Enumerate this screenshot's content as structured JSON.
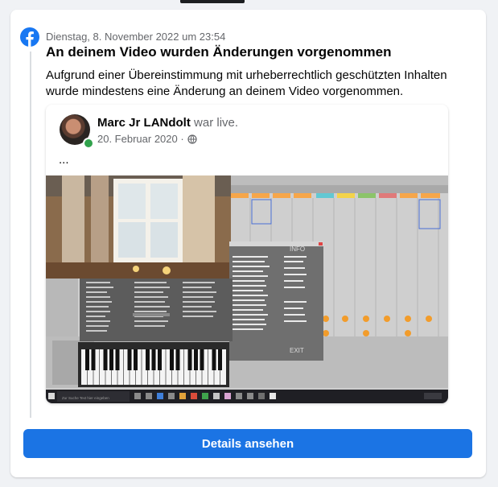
{
  "notification": {
    "timestamp": "Dienstag, 8. November 2022 um 23:54",
    "title": "An deinem Video wurden Änderungen vorgenommen",
    "body": "Aufgrund einer Übereinstimmung mit urheberrechtlich geschützten Inhalten wurde mindestens eine Änderung an deinem Video vorgenommen."
  },
  "post": {
    "author": "Marc Jr LANdolt",
    "author_suffix": "war live.",
    "date": "20. Februar 2020 ·",
    "text": "...",
    "privacy_icon": "globe-icon",
    "media_icon_window": "info-dialog-icon",
    "media_dialog_title": "INFO",
    "media_dialog_button": "EXIT",
    "media_taskbar_search": "Zur Suche Text hier eingeben"
  },
  "action": {
    "label": "Details ansehen"
  },
  "colors": {
    "accent": "#1b74e4",
    "facebook_blue": "#1877f2",
    "online": "#31a24c"
  }
}
